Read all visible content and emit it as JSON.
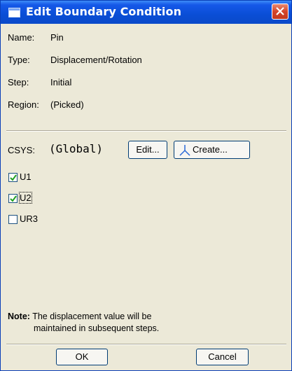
{
  "window": {
    "title": "Edit Boundary Condition",
    "icon": "window-app-icon",
    "close_icon": "close-icon"
  },
  "info": {
    "name_label": "Name:",
    "name_value": "Pin",
    "type_label": "Type:",
    "type_value": "Displacement/Rotation",
    "step_label": "Step:",
    "step_value": "Initial",
    "region_label": "Region:",
    "region_value": "(Picked)"
  },
  "csys": {
    "label": "CSYS:",
    "value": "(Global)",
    "edit_label": "Edit...",
    "create_label": "Create...",
    "create_icon": "axes-icon"
  },
  "dofs": [
    {
      "label": "U1",
      "checked": true
    },
    {
      "label": "U2",
      "checked": true
    },
    {
      "label": "UR3",
      "checked": false
    }
  ],
  "note": {
    "title": "Note:",
    "line1": "The displacement value will be",
    "line2": "maintained in subsequent steps."
  },
  "footer": {
    "ok_label": "OK",
    "cancel_label": "Cancel"
  },
  "colors": {
    "titlebar": "#0a4ed6",
    "dialog_bg": "#ece9d8",
    "checkmark": "#21a121",
    "close_button": "#d4442a"
  }
}
